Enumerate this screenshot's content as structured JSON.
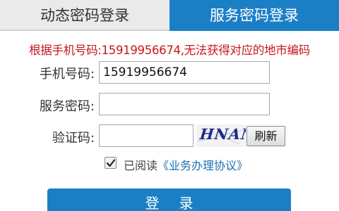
{
  "tabs": {
    "dynamic_login": "动态密码登录",
    "service_login": "服务密码登录"
  },
  "error_message": "根据手机号码:15919956674,无法获得对应的地市编码",
  "form": {
    "phone_label": "手机号码:",
    "phone_value": "15919956674",
    "password_label": "服务密码:",
    "password_value": "",
    "captcha_label": "验证码:",
    "captcha_value": "",
    "captcha_image_text": "HNAN",
    "refresh_label": "刷新"
  },
  "agreement": {
    "checked": true,
    "prefix": "已阅读",
    "link_text": "《业务办理协议》"
  },
  "login_button": "登录",
  "colors": {
    "accent": "#1b7fc6",
    "error": "#c8161d",
    "link": "#1b6fb5"
  }
}
